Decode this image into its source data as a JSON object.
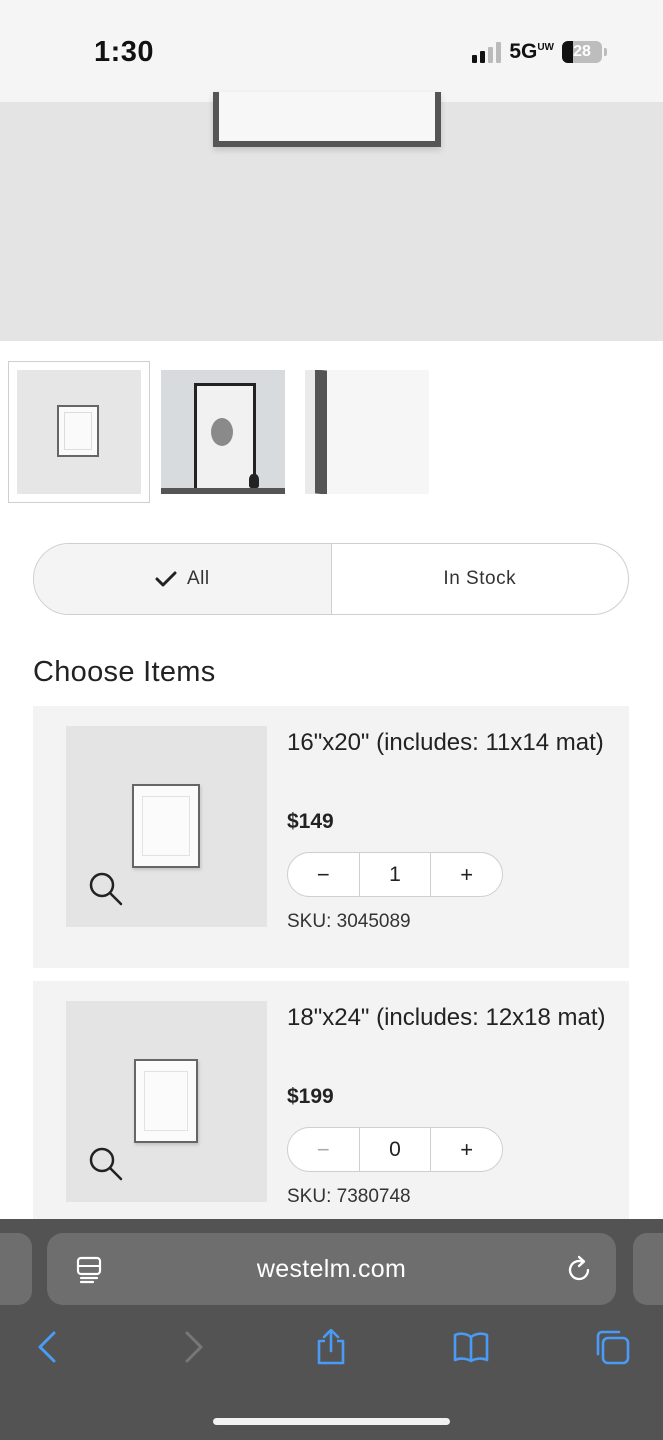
{
  "status_bar": {
    "time": "1:30",
    "network": "5G",
    "network_suffix": "UW",
    "battery": "28",
    "battery_level": 0.28
  },
  "hero": {
    "image_alt": "frame product image"
  },
  "thumbnails": [
    {
      "name": "frame-front-view",
      "active": true
    },
    {
      "name": "frame-wall-view",
      "active": false
    },
    {
      "name": "frame-corner-detail",
      "active": false
    }
  ],
  "filter": {
    "all_label": "All",
    "in_stock_label": "In Stock",
    "selected": "All"
  },
  "section_title": "Choose Items",
  "products": [
    {
      "title": "16\"x20\" (includes: 11x14 mat)",
      "price": "$149",
      "quantity": "1",
      "minus": "−",
      "plus": "+",
      "sku": "SKU: 3045089"
    },
    {
      "title": "18\"x24\" (includes: 12x18 mat)",
      "price": "$199",
      "quantity": "0",
      "minus": "−",
      "plus": "+",
      "sku": "SKU: 7380748"
    }
  ],
  "browser": {
    "url": "westelm.com",
    "icons": [
      "reader-icon",
      "reload-icon",
      "back-icon",
      "forward-icon",
      "share-icon",
      "bookmarks-icon",
      "tabs-icon"
    ],
    "accent": "#4a9bf5"
  }
}
